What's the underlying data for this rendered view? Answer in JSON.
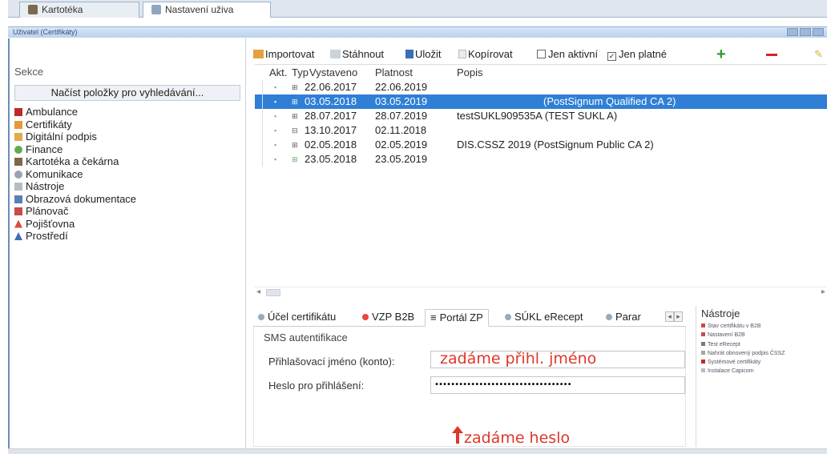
{
  "doc_tabs": [
    {
      "label": "Kartotéka"
    },
    {
      "label": "Nastavení uživa"
    }
  ],
  "window_title": "Uživatel (Certifikáty)",
  "left": {
    "section_label": "Sekce",
    "load_button": "Načíst položky pro vyhledávání...",
    "items": [
      {
        "label": "Ambulance",
        "color": "#c0282d"
      },
      {
        "label": "Certifikáty",
        "color": "#e39a3a"
      },
      {
        "label": "Digitální podpis",
        "color": "#e3a94a"
      },
      {
        "label": "Finance",
        "color": "#5fae4a"
      },
      {
        "label": "Kartotéka a čekárna",
        "color": "#7a6a4a"
      },
      {
        "label": "Komunikace",
        "color": "#9aa3ad"
      },
      {
        "label": "Nástroje",
        "color": "#b4bcc6"
      },
      {
        "label": "Obrazová dokumentace",
        "color": "#5b7fb4"
      },
      {
        "label": "Plánovač",
        "color": "#c94a4a"
      },
      {
        "label": "Pojišťovna",
        "color": "#d6513d"
      },
      {
        "label": "Prostředí",
        "color": "#3d6fb4"
      }
    ]
  },
  "toolbar": {
    "import": "Importovat",
    "download": "Stáhnout",
    "save": "Uložit",
    "copy": "Kopírovat",
    "only_active": "Jen aktivní",
    "only_valid": "Jen platné",
    "only_active_checked": false,
    "only_valid_checked": true
  },
  "grid": {
    "headers": {
      "akt": "Akt.",
      "typ": "Typ",
      "issued": "Vystaveno",
      "valid": "Platnost",
      "desc": "Popis"
    },
    "rows": [
      {
        "issued": "22.06.2017",
        "valid": "22.06.2019",
        "desc": "",
        "selected": false
      },
      {
        "issued": "03.05.2018",
        "valid": "03.05.2019",
        "desc": "(PostSignum Qualified CA 2)",
        "selected": true
      },
      {
        "issued": "28.07.2017",
        "valid": "28.07.2019",
        "desc": "testSUKL909535A (TEST SUKL A)",
        "selected": false
      },
      {
        "issued": "13.10.2017",
        "valid": "02.11.2018",
        "desc": "",
        "selected": false
      },
      {
        "issued": "02.05.2018",
        "valid": "02.05.2019",
        "desc": "DIS.CSSZ 2019 (PostSignum Public CA 2)",
        "selected": false
      },
      {
        "issued": "23.05.2018",
        "valid": "23.05.2019",
        "desc": "",
        "selected": false
      }
    ]
  },
  "bottom_tabs": [
    {
      "label": "Účel certifikátu",
      "active": false
    },
    {
      "label": "VZP B2B",
      "active": false
    },
    {
      "label": "Portál ZP",
      "active": true
    },
    {
      "label": "SÚKL eRecept",
      "active": false
    },
    {
      "label": "Parar",
      "active": false
    }
  ],
  "sms_panel": {
    "title": "SMS autentifikace",
    "login_label": "Přihlašovací jméno (konto):",
    "password_label": "Heslo pro přihlášení:",
    "password_value": "••••••••••••••••••••••••••••••••••"
  },
  "annotations": {
    "login_hint": "zadáme přihl. jméno",
    "password_hint": "zadáme heslo"
  },
  "tools": {
    "title": "Nástroje",
    "items": [
      {
        "label": "Stav certifikátu v B2B",
        "color": "#c94a4a"
      },
      {
        "label": "Nastavení B2B",
        "color": "#c94a4a"
      },
      {
        "label": "Test eRecept",
        "color": "#7a7a7a"
      },
      {
        "label": "Nahrát obnovený podpis ČSSZ",
        "color": "#9aa"
      },
      {
        "label": "Systémové certifikáty",
        "color": "#c0282d"
      },
      {
        "label": "Instalace Capicom",
        "color": "#b4bcc6"
      }
    ]
  }
}
